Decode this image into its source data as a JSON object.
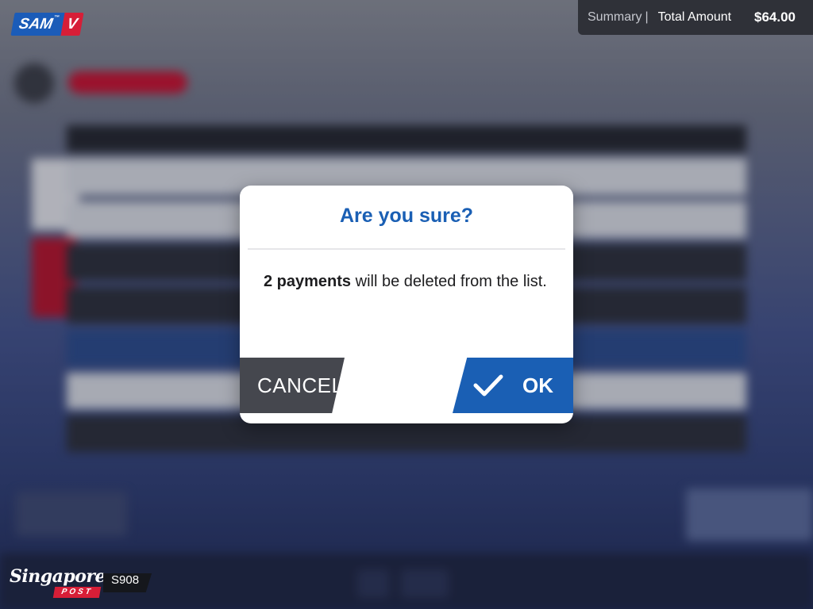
{
  "brand": {
    "sam": "SAM",
    "sam_tm": "™",
    "sam_v": "V"
  },
  "summary": {
    "label": "Summary",
    "separator": "|",
    "total_label": "Total Amount",
    "amount": "$64.00"
  },
  "dialog": {
    "title": "Are you sure?",
    "message_bold": "2 payments",
    "message_rest": " will be deleted from the list.",
    "cancel_label": "CANCEL",
    "ok_label": "OK"
  },
  "footer": {
    "logo_script": "Singapore",
    "logo_post": "POST",
    "kiosk_id": "S908"
  },
  "colors": {
    "primary_blue": "#1a5fb4",
    "brand_red": "#d71e37",
    "cancel_gray": "#45474e",
    "summary_bg": "#2f3138"
  },
  "icons": {
    "ok": "check-icon"
  }
}
